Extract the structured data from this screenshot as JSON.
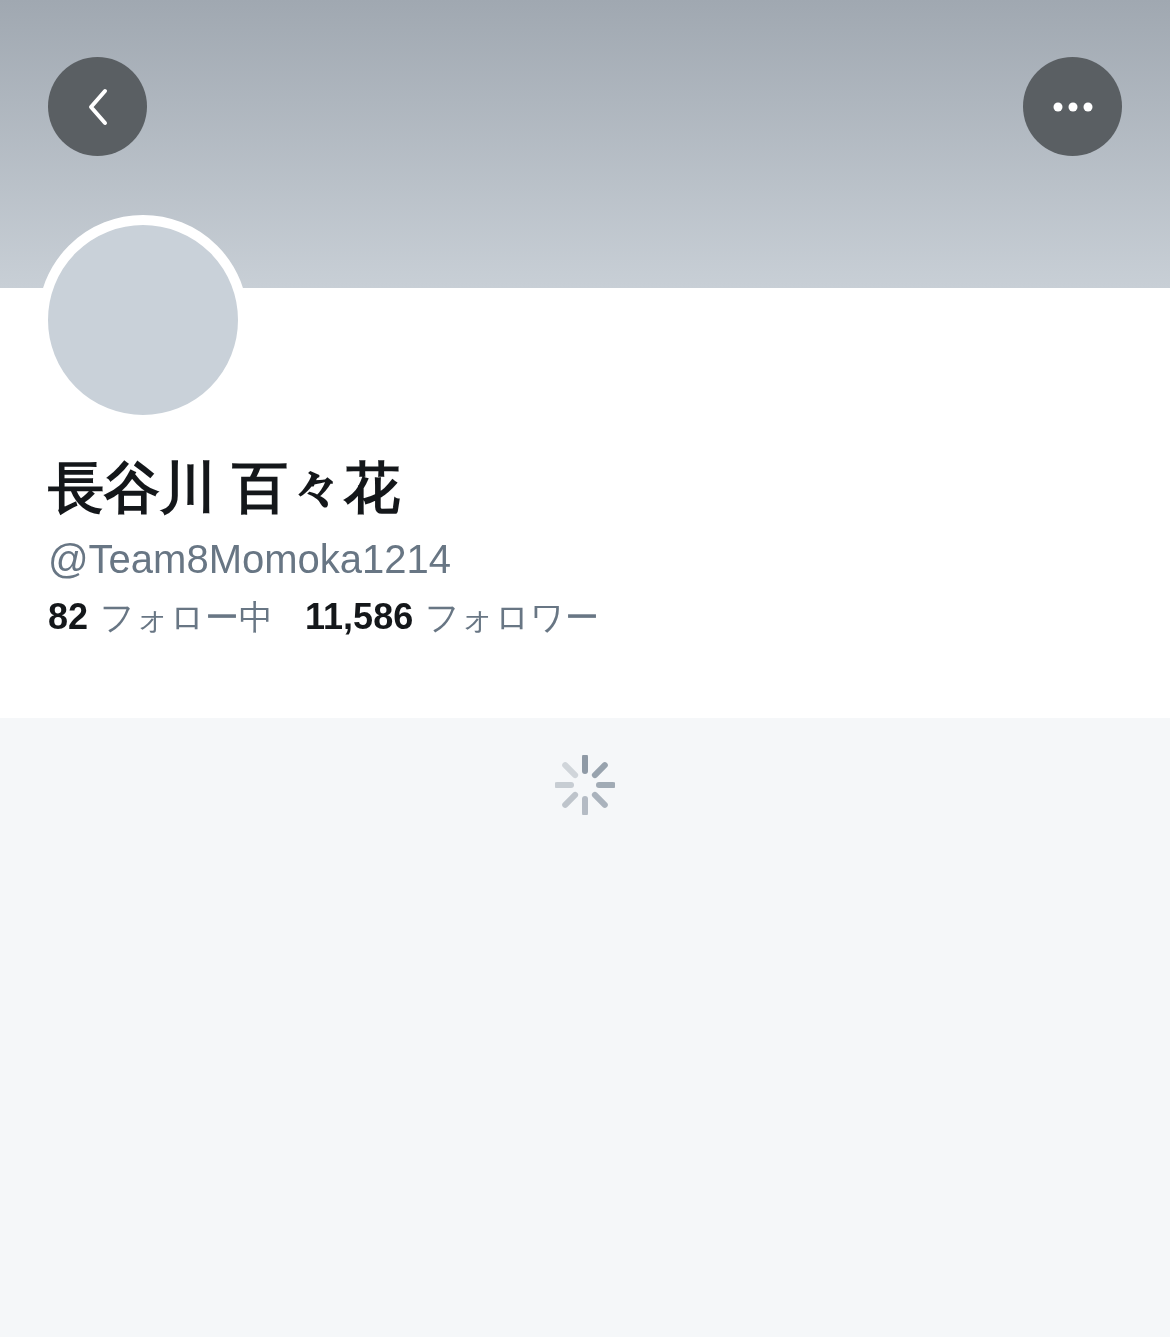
{
  "profile": {
    "name": "長谷川 百々花",
    "handle": "@Team8Momoka1214",
    "stats": [
      {
        "count": "82",
        "label": "フォロー中"
      },
      {
        "count": "11,586",
        "label": "フォロワー"
      }
    ]
  },
  "timeline": {
    "loading": true
  }
}
